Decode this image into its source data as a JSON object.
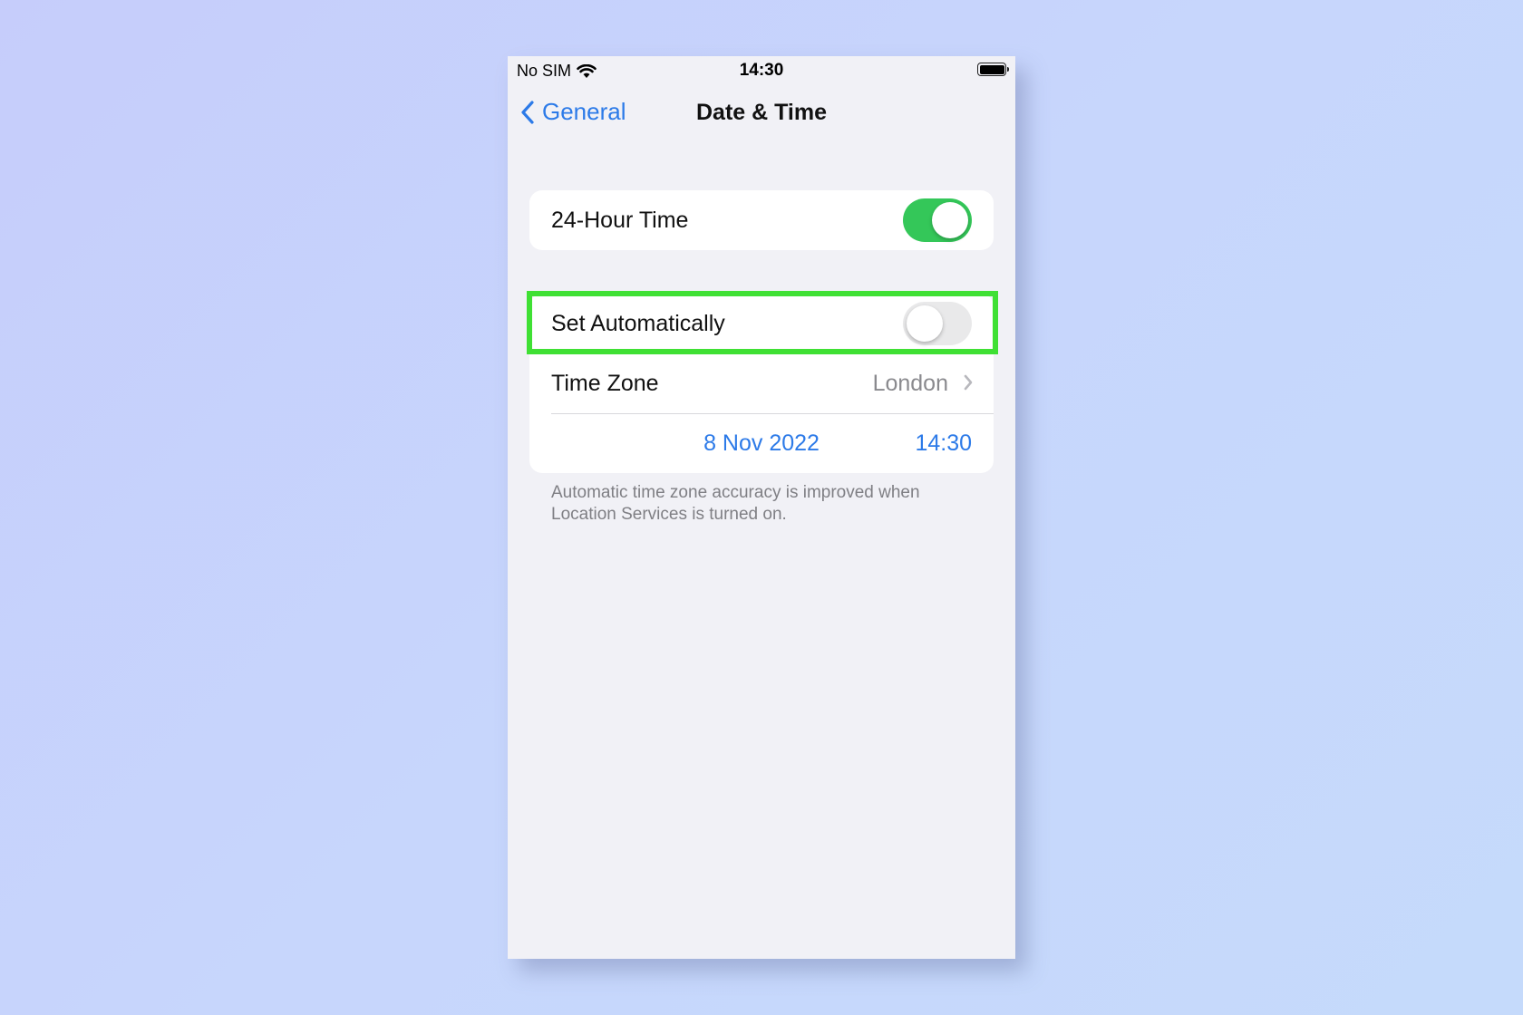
{
  "status_bar": {
    "carrier": "No SIM",
    "time": "14:30"
  },
  "nav": {
    "back_label": "General",
    "title": "Date & Time"
  },
  "settings": {
    "hour24": {
      "label": "24-Hour Time",
      "on": true
    },
    "set_automatically": {
      "label": "Set Automatically",
      "on": false
    },
    "time_zone": {
      "label": "Time Zone",
      "value": "London"
    },
    "date": "8 Nov 2022",
    "time": "14:30"
  },
  "footnote": "Automatic time zone accuracy is improved when Location Services is turned on.",
  "colors": {
    "accent": "#2c7ae8",
    "toggle_on": "#34c759",
    "highlight": "#3fe034"
  }
}
